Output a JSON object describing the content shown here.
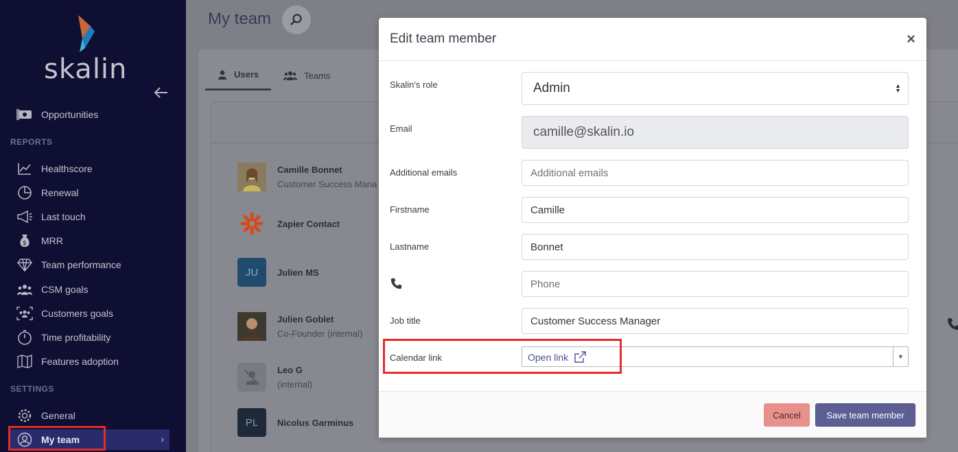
{
  "app": {
    "logo_text": "skalin"
  },
  "sidebar": {
    "top_items": [
      {
        "label": "Opportunities",
        "icon": "money-icon"
      }
    ],
    "reports_label": "REPORTS",
    "reports": [
      {
        "label": "Healthscore",
        "icon": "chart-line-icon"
      },
      {
        "label": "Renewal",
        "icon": "pie-chart-icon"
      },
      {
        "label": "Last touch",
        "icon": "megaphone-icon"
      },
      {
        "label": "MRR",
        "icon": "money-bag-icon"
      },
      {
        "label": "Team performance",
        "icon": "diamond-icon"
      },
      {
        "label": "CSM goals",
        "icon": "users-icon"
      },
      {
        "label": "Customers goals",
        "icon": "users-frame-icon"
      },
      {
        "label": "Time profitability",
        "icon": "stopwatch-icon"
      },
      {
        "label": "Features adoption",
        "icon": "map-icon"
      }
    ],
    "settings_label": "SETTINGS",
    "settings": [
      {
        "label": "General",
        "icon": "gear-icon"
      },
      {
        "label": "My team",
        "icon": "user-circle-icon"
      }
    ]
  },
  "main": {
    "title": "My team",
    "tabs": [
      {
        "label": "Users",
        "icon": "user-icon"
      },
      {
        "label": "Teams",
        "icon": "users-icon"
      }
    ],
    "members": [
      {
        "name": "Camille Bonnet",
        "sub": "Customer Success Mana",
        "initials": ""
      },
      {
        "name": "Zapier Contact",
        "sub": "",
        "initials": ""
      },
      {
        "name": "Julien MS",
        "sub": "",
        "initials": "JU"
      },
      {
        "name": "Julien Goblet",
        "sub": "Co-Founder (internal)",
        "initials": ""
      },
      {
        "name": "Leo G",
        "sub": "(internal)",
        "initials": ""
      },
      {
        "name": "Nicolus Garminus",
        "sub": "",
        "initials": "PL"
      }
    ]
  },
  "modal": {
    "title": "Edit team member",
    "close": "×",
    "role_label": "Skalin's role",
    "role_value": "Admin",
    "email_label": "Email",
    "email_value": "camille@skalin.io",
    "additional_emails_label": "Additional emails",
    "additional_emails_placeholder": "Additional emails",
    "firstname_label": "Firstname",
    "firstname_value": "Camille",
    "lastname_label": "Lastname",
    "lastname_value": "Bonnet",
    "phone_placeholder": "Phone",
    "job_title_label": "Job title",
    "job_title_value": "Customer Success Manager",
    "calendar_label": "Calendar link",
    "calendar_link_text": "Open link",
    "cancel_label": "Cancel",
    "save_label": "Save team member"
  },
  "colors": {
    "sidebar_bg": "#0e0f33",
    "accent": "#5d5f94",
    "highlight": "#e52b2b",
    "cancel": "#e8908c"
  }
}
